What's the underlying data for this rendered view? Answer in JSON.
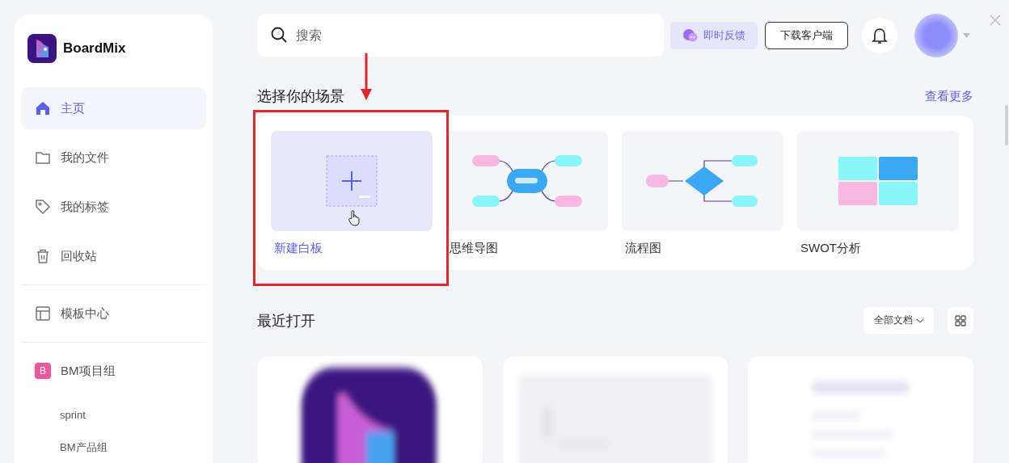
{
  "sidebar": {
    "brand": "BoardMix",
    "sections": [
      [
        {
          "kind": "nav",
          "label": "主页",
          "selected": true
        },
        {
          "kind": "nav",
          "label": "我的文件",
          "selected": false
        },
        {
          "kind": "nav",
          "label": "我的标签",
          "selected": false
        },
        {
          "kind": "nav",
          "label": "回收站",
          "selected": false
        }
      ],
      [
        {
          "kind": "nav",
          "label": "模板中心",
          "selected": false
        }
      ],
      [
        {
          "kind": "group",
          "label": "BM项目组",
          "badge": "B",
          "color": "#f0569e",
          "selected": false
        },
        {
          "kind": "sub",
          "label": "sprint",
          "selected": false
        },
        {
          "kind": "sub",
          "label": "BM产品组",
          "selected": false
        }
      ]
    ]
  },
  "search": {
    "placeholder": "搜索"
  },
  "feedback_button": "即时反馈",
  "download_button": "下载客户端",
  "scenes": {
    "title": "选择你的场景",
    "more_link": "查看更多",
    "items": [
      {
        "label": "新建白板",
        "selected": true
      },
      {
        "label": "思维导图",
        "selected": false
      },
      {
        "label": "流程图",
        "selected": false
      },
      {
        "label": "SWOT分析",
        "selected": false
      }
    ]
  },
  "recent": {
    "title": "最近打开",
    "filter": "全部文档"
  }
}
